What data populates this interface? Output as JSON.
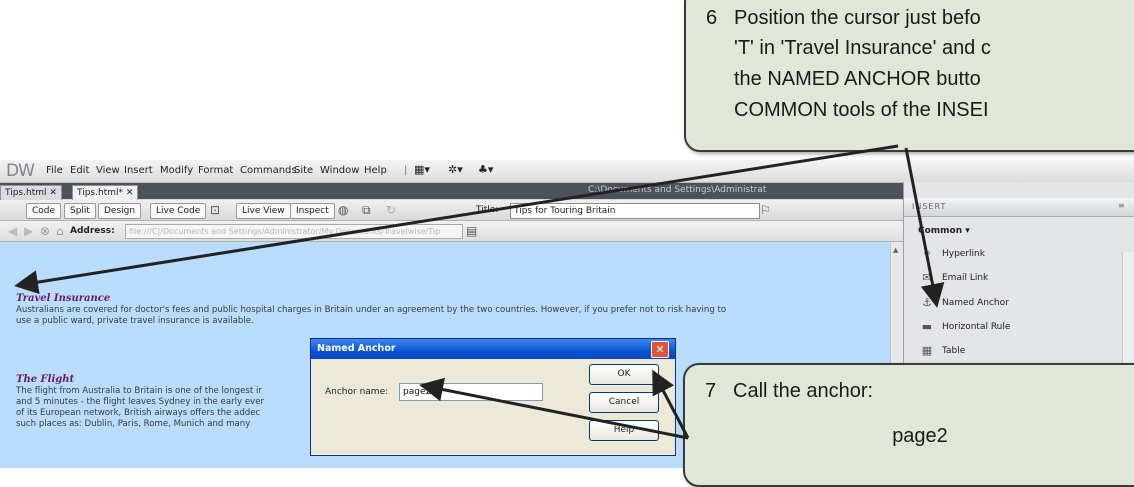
{
  "app": {
    "logo": "DW",
    "menu": [
      "File",
      "Edit",
      "View",
      "Insert",
      "Modify",
      "Format",
      "Commands",
      "Site",
      "Window",
      "Help"
    ],
    "tabs": [
      "Tips.html",
      "Tips.html*"
    ],
    "path": "C:\\Documents and Settings\\Administrat"
  },
  "toolbar": {
    "code": "Code",
    "split": "Split",
    "design": "Design",
    "live_code": "Live Code",
    "live_view": "Live View",
    "inspect": "Inspect",
    "title_label": "Title:",
    "title_value": "Tips for Touring Britain"
  },
  "address": {
    "label": "Address:",
    "value": "file:///C|/Documents and Settings/Administrator/My Documents/Travelwise/Tip"
  },
  "document": {
    "h1": "Travel Insurance",
    "p1a": "Australians are covered for doctor's fees and public hospital charges in Britain under an agreement by the two countries. However, if you prefer not to risk having to",
    "p1b": "use a public ward, private travel insurance is available.",
    "h2": "The Flight",
    "p2a": "The flight from Australia to Britain is one of the longest ir",
    "p2b": "and 5 minutes - the flight leaves Sydney in the early ever",
    "p2c": "of its European network, British airways offers the addec",
    "p2d": "such places as: Dublin, Paris, Rome, Munich and many"
  },
  "insert_panel": {
    "title": "INSERT",
    "category": "Common",
    "items": [
      "Hyperlink",
      "Email Link",
      "Named Anchor",
      "Horizontal Rule",
      "Table"
    ]
  },
  "dialog": {
    "title": "Named Anchor",
    "anchor_label": "Anchor name:",
    "anchor_value": "page2",
    "ok": "OK",
    "cancel": "Cancel",
    "help": "Help"
  },
  "callouts": {
    "c6_num": "6",
    "c6_lines": [
      "Position the cursor just befo",
      "'T' in 'Travel Insurance' and c",
      "the NAMED ANCHOR butto",
      "COMMON tools of the INSEI"
    ],
    "c7_num": "7",
    "c7_text": "Call the anchor:",
    "c7_name": "page2"
  }
}
